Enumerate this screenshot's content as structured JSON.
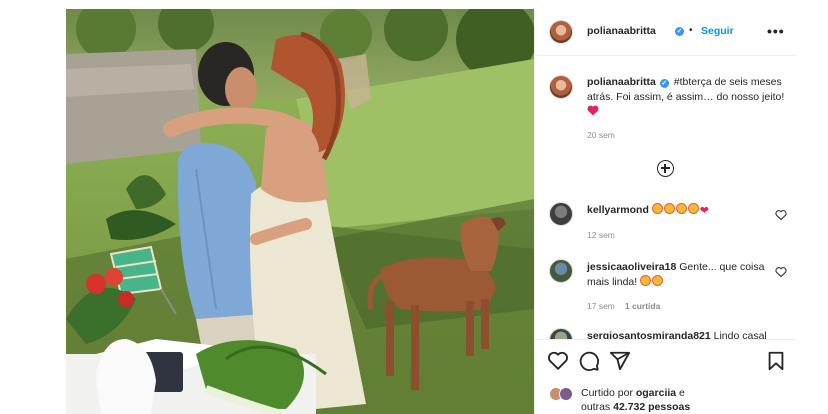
{
  "post": {
    "username": "polianaabritta",
    "follow_label": "Seguir",
    "separator": "•",
    "verified_mark": "✓",
    "more_label": "•••",
    "caption": {
      "username": "polianaabritta",
      "text": " #tbterça de seis meses atrás. Foi assim, é assim… do nosso jeito!",
      "emoji": "red-heart",
      "time": "20 sem"
    },
    "load_more_icon": "plus-circle-icon"
  },
  "comments": [
    {
      "username": "kellyarmond",
      "text": "",
      "emojis": [
        "heart-eyes-face",
        "heart-eyes-face",
        "heart-eyes-face",
        "heart-eyes-face",
        "red-heart"
      ],
      "time": "12 sem",
      "likes": ""
    },
    {
      "username": "jessicaaoliveira18",
      "text": " Gente... que coisa mais linda!",
      "emojis": [
        "heart-eyes-face",
        "hugging-face"
      ],
      "time": "17 sem",
      "likes": "1 curtida"
    },
    {
      "username": "sergiosantosmiranda821",
      "text": " Lindo casal",
      "emojis": [],
      "time": "",
      "likes": ""
    }
  ],
  "actions": {
    "icons": [
      "heart-icon",
      "comment-icon",
      "share-icon",
      "bookmark-icon"
    ]
  },
  "liked_by": {
    "prefix": "Curtido por ",
    "user": "ogarciia",
    "middle": " e",
    "line2_prefix": "outras ",
    "count": "42.732 pessoas"
  },
  "colors": {
    "accent": "#0095f6",
    "verified": "#3897f0",
    "heart": "#ed4956",
    "muted": "#8e8e8e"
  }
}
